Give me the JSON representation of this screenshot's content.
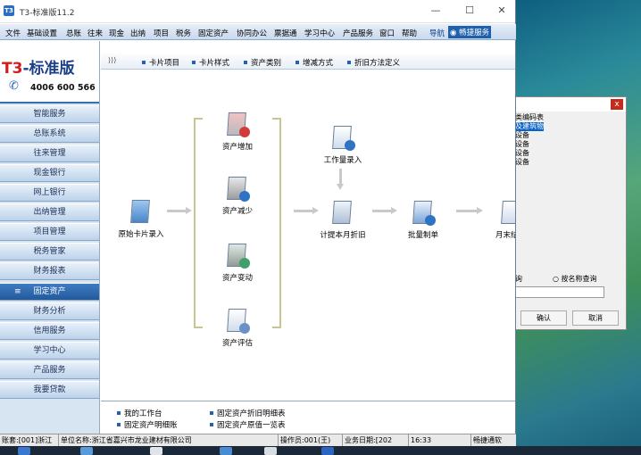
{
  "window": {
    "title": "T3-标准版11.2",
    "app_icon_text": "T3"
  },
  "menu": {
    "items": [
      "文件",
      "基础设置",
      "总账",
      "往来",
      "现金",
      "出纳",
      "项目",
      "税务",
      "固定资产",
      "协同办公",
      "票据通",
      "学习中心",
      "产品服务",
      "窗口",
      "帮助"
    ],
    "right_nav": "导航",
    "right_service": "畅捷服务"
  },
  "logo": {
    "brand_prefix": "T3",
    "brand_suffix": "-标准版",
    "phone": "4006 600 566"
  },
  "sidebar": {
    "items": [
      {
        "label": "智能服务"
      },
      {
        "label": "总账系统"
      },
      {
        "label": "往来管理"
      },
      {
        "label": "现金银行"
      },
      {
        "label": "网上银行"
      },
      {
        "label": "出纳管理"
      },
      {
        "label": "项目管理"
      },
      {
        "label": "税务管家"
      },
      {
        "label": "财务报表"
      },
      {
        "label": "固定资产",
        "active": true
      },
      {
        "label": "财务分析"
      },
      {
        "label": "信用服务"
      },
      {
        "label": "学习中心"
      },
      {
        "label": "产品服务"
      },
      {
        "label": "我要贷款"
      }
    ],
    "active_bullet": "≡"
  },
  "tabs": {
    "arrows": "⟩⟩⟩",
    "items": [
      "卡片项目",
      "卡片样式",
      "资产类别",
      "增减方式",
      "折旧方法定义"
    ]
  },
  "flow": {
    "original_card": "原始卡片录入",
    "add": "资产增加",
    "reduce": "资产减少",
    "change": "资产变动",
    "evaluate": "资产评估",
    "workload": "工作量录入",
    "depreciation": "计提本月折旧",
    "voucher": "批量制单",
    "month_end": "月末结"
  },
  "bottom_links": {
    "my_desk": "我的工作台",
    "asset_detail": "固定资产明细账",
    "depr_detail": "固定资产折旧明细表",
    "original_value": "固定资产原值一览表"
  },
  "status": {
    "account": "账套:[001]浙江",
    "unit": "单位名称:浙江省嘉兴市龙业建材有限公司",
    "operator": "操作员:001(王)",
    "biz_date": "业务日期:[202",
    "time": "16:33",
    "brand": "畅捷通软"
  },
  "dialog": {
    "close": "x",
    "list": [
      "类编码表",
      "及建筑物",
      "设备",
      "设备",
      "设备",
      "设备"
    ],
    "selected_index": 1,
    "radio1": "询",
    "radio2": "按名称查询",
    "ok": "确认",
    "cancel": "取消"
  },
  "colors": {
    "accent": "#2c6fc2",
    "sidebar_active": "#2f68ad",
    "menubar": "#d6e3f3",
    "brand_red": "#d21d1d"
  }
}
